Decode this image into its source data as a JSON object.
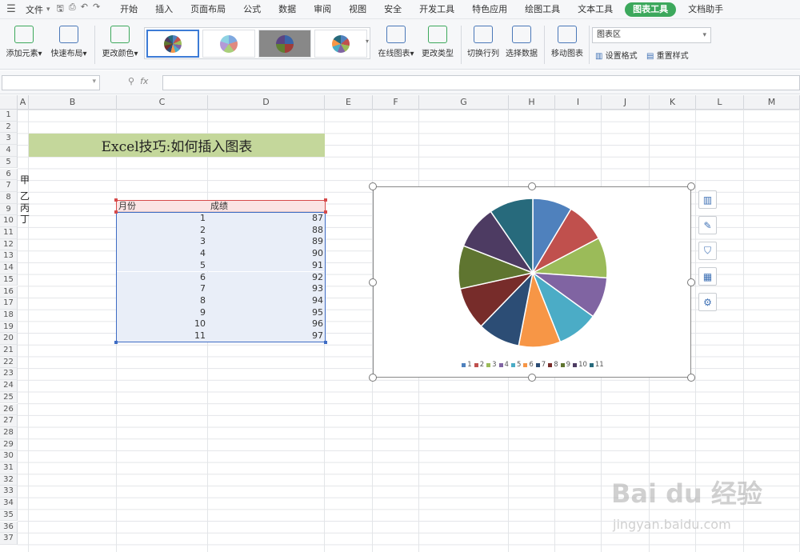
{
  "menubar": {
    "file_label": "文件",
    "tabs": [
      "开始",
      "插入",
      "页面布局",
      "公式",
      "数据",
      "审阅",
      "视图",
      "安全",
      "开发工具",
      "特色应用",
      "绘图工具",
      "文本工具",
      "图表工具",
      "文档助手"
    ],
    "active_tab": "图表工具"
  },
  "ribbon": {
    "add_element": "添加元素",
    "quick_layout": "快速布局",
    "change_color": "更改颜色",
    "online_chart": "在线图表",
    "change_type": "更改类型",
    "switch_rowcol": "切换行列",
    "select_data": "选择数据",
    "move_chart": "移动图表",
    "chart_area_select": "图表区",
    "set_format": "设置格式",
    "reset_style": "重置样式"
  },
  "formula_bar": {
    "fx": "fx",
    "value": ""
  },
  "columns": [
    "A",
    "B",
    "C",
    "D",
    "E",
    "F",
    "G",
    "H",
    "I",
    "J",
    "K",
    "L",
    "M"
  ],
  "rows": [
    "1",
    "2",
    "3",
    "4",
    "5",
    "6",
    "7",
    "8",
    "9",
    "10",
    "11",
    "12",
    "13",
    "14",
    "15",
    "16",
    "17",
    "18",
    "19",
    "20",
    "21",
    "22",
    "23",
    "24",
    "25",
    "26",
    "27",
    "28",
    "29",
    "30",
    "31",
    "32",
    "33",
    "34",
    "35",
    "36",
    "37"
  ],
  "sheet": {
    "title": "Excel技巧:如何插入图表",
    "side_labels": [
      "甲",
      "乙",
      "丙",
      "丁"
    ],
    "table": {
      "headers": [
        "月份",
        "成绩"
      ],
      "months": [
        "1",
        "2",
        "3",
        "4",
        "5",
        "6",
        "7",
        "8",
        "9",
        "10",
        "11"
      ],
      "scores": [
        "87",
        "88",
        "89",
        "90",
        "91",
        "92",
        "93",
        "94",
        "95",
        "96",
        "97"
      ]
    }
  },
  "chart_data": {
    "type": "pie",
    "categories": [
      "1",
      "2",
      "3",
      "4",
      "5",
      "6",
      "7",
      "8",
      "9",
      "10",
      "11"
    ],
    "values": [
      87,
      88,
      89,
      90,
      91,
      92,
      93,
      94,
      95,
      96,
      97
    ],
    "colors": [
      "#4f81bd",
      "#c0504d",
      "#9bbb59",
      "#8064a2",
      "#4bacc6",
      "#f79646",
      "#2c4d75",
      "#772c2a",
      "#5f7530",
      "#4d3b62",
      "#276a7c"
    ],
    "legend": "bottom",
    "title": ""
  },
  "watermark": {
    "brand": "Bai du 经验",
    "url": "jingyan.baidu.com"
  }
}
